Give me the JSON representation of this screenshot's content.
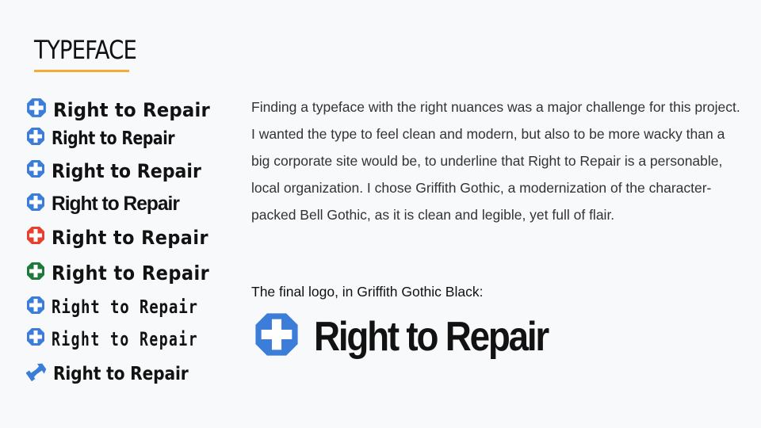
{
  "slide": {
    "title": "TYPEFACE",
    "accent_color": "#f7ab35"
  },
  "variants": [
    {
      "label": "Right to Repair",
      "icon": "plus-shield-icon",
      "color": "#3b7dd8"
    },
    {
      "label": "Right to Repair",
      "icon": "plus-shield-icon",
      "color": "#3b7dd8"
    },
    {
      "label": "Right to Repair",
      "icon": "plus-shield-icon",
      "color": "#3b7dd8"
    },
    {
      "label": "Right to Repair",
      "icon": "plus-shield-icon",
      "color": "#3b7dd8"
    },
    {
      "label": "Right to Repair",
      "icon": "plus-shield-icon",
      "color": "#e8402f"
    },
    {
      "label": "Right to Repair",
      "icon": "plus-shield-icon",
      "color": "#1d7a3a"
    },
    {
      "label": "Right to Repair",
      "icon": "plus-shield-icon",
      "color": "#3b7dd8"
    },
    {
      "label": "Right to Repair",
      "icon": "plus-shield-icon",
      "color": "#3b7dd8"
    },
    {
      "label": "Right to Repair",
      "icon": "wrench-screwdriver-icon",
      "color": "#3b7dd8"
    }
  ],
  "description": "Finding a typeface with the right nuances was a major challenge for this project. I wanted the type to feel clean and modern, but also to be more wacky than a big corporate site would be, to underline that Right to Repair is a personable, local organization. I chose Griffith Gothic, a modernization of the character-packed Bell Gothic, as it is clean and legible, yet full of flair.",
  "final_logo": {
    "caption": "The final logo, in Griffith Gothic Black:",
    "label": "Right to Repair",
    "icon": "plus-shield-icon",
    "color": "#3b7dd8"
  }
}
